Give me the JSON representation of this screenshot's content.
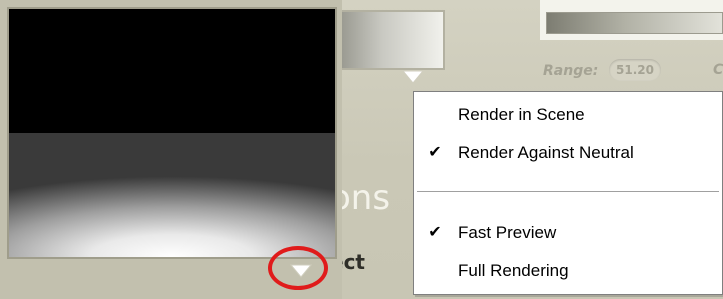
{
  "panel": {
    "range_label": "Range:",
    "range_value": "51.20",
    "cut_glyph": "C",
    "partial_heading": "ons",
    "partial_button_text": "ect"
  },
  "preview": {
    "menu_arrow_icon": "triangle-down-icon"
  },
  "context_menu": {
    "items": [
      {
        "label": "Render in Scene",
        "checked": false,
        "check_glyph": ""
      },
      {
        "label": "Render Against Neutral",
        "checked": true,
        "check_glyph": "✔"
      },
      {
        "label": "Fast Preview",
        "checked": true,
        "check_glyph": "✔"
      },
      {
        "label": "Full Rendering",
        "checked": false,
        "check_glyph": ""
      }
    ]
  },
  "colors": {
    "highlight_ring": "#e01b1b",
    "panel_background": "#cac8b6",
    "menu_background": "#ffffff"
  }
}
